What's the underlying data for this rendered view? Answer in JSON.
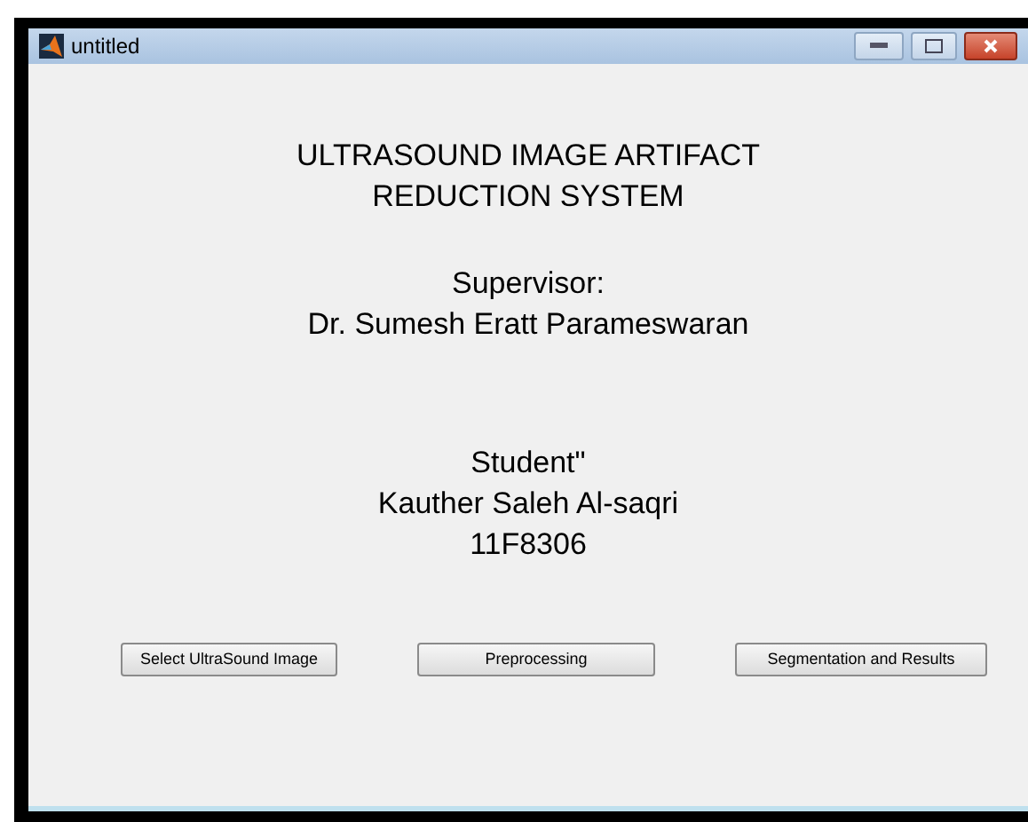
{
  "window": {
    "title": "untitled"
  },
  "title_lines": [
    "ULTRASOUND IMAGE ARTIFACT",
    "REDUCTION SYSTEM"
  ],
  "supervisor_lines": [
    "Supervisor:",
    "Dr. Sumesh Eratt Parameswaran"
  ],
  "student_lines": [
    "Student\"",
    "Kauther Saleh Al-saqri",
    "11F8306"
  ],
  "buttons": [
    "Select UltraSound Image",
    "Preprocessing",
    "Segmentation and Results"
  ]
}
